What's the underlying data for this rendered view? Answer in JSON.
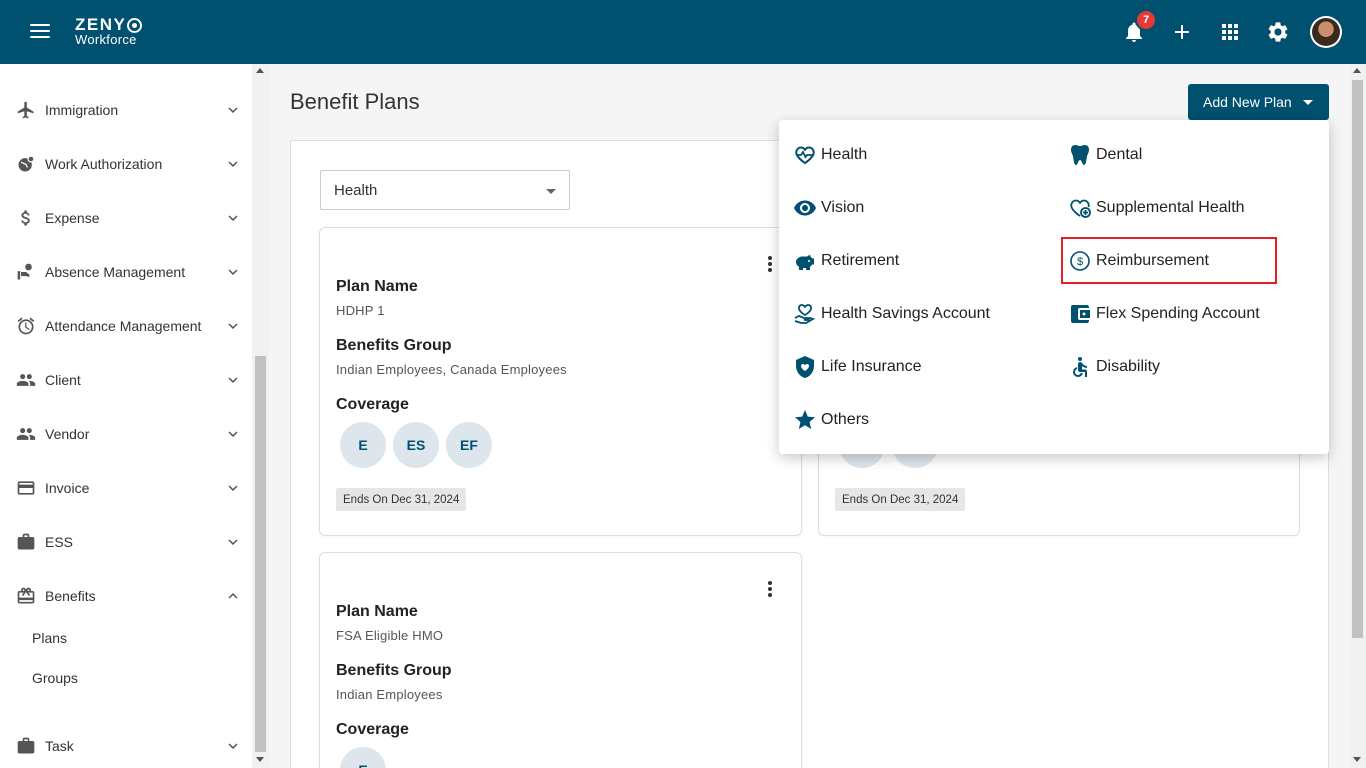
{
  "app": {
    "brand_top": "ZENY",
    "brand_bottom": "Workforce",
    "notification_count": "7"
  },
  "colors": {
    "topbar": "#00506f",
    "accent": "#00506f",
    "logo_accent": "#f39c3c",
    "badge": "#e53935",
    "highlight": "#e31e24"
  },
  "sidebar": {
    "items": [
      {
        "label": "Immigration",
        "icon": "airplane-icon"
      },
      {
        "label": "Work Authorization",
        "icon": "globe-icon"
      },
      {
        "label": "Expense",
        "icon": "dollar-icon"
      },
      {
        "label": "Absence Management",
        "icon": "absence-icon"
      },
      {
        "label": "Attendance Management",
        "icon": "alarm-clock-icon"
      },
      {
        "label": "Client",
        "icon": "people-icon"
      },
      {
        "label": "Vendor",
        "icon": "people-icon"
      },
      {
        "label": "Invoice",
        "icon": "card-icon"
      },
      {
        "label": "ESS",
        "icon": "briefcase-icon"
      },
      {
        "label": "Benefits",
        "icon": "gift-icon",
        "expanded": true
      },
      {
        "label": "Task",
        "icon": "briefcase-icon"
      }
    ],
    "benefits_sub": [
      "Plans",
      "Groups"
    ]
  },
  "main": {
    "title": "Benefit Plans",
    "add_button": "Add New Plan",
    "filter_value": "Health"
  },
  "cards": [
    {
      "plan_name_label": "Plan Name",
      "plan_name": "HDHP 1",
      "group_label": "Benefits Group",
      "group": "Indian Employees, Canada Employees",
      "coverage_label": "Coverage",
      "coverage": [
        "E",
        "ES",
        "EF"
      ],
      "ends": "Ends On Dec 31, 2024"
    },
    {
      "ends": "Ends On Dec 31, 2024"
    },
    {
      "plan_name_label": "Plan Name",
      "plan_name": "FSA Eligible HMO",
      "group_label": "Benefits Group",
      "group": "Indian Employees",
      "coverage_label": "Coverage",
      "coverage": [
        "E"
      ]
    }
  ],
  "dropdown": {
    "left": [
      {
        "label": "Health",
        "icon": "heart-pulse-icon"
      },
      {
        "label": "Vision",
        "icon": "eye-icon"
      },
      {
        "label": "Retirement",
        "icon": "piggy-bank-icon"
      },
      {
        "label": "Health Savings Account",
        "icon": "hand-heart-dollar-icon"
      },
      {
        "label": "Life Insurance",
        "icon": "shield-heart-icon"
      },
      {
        "label": "Others",
        "icon": "star-icon"
      }
    ],
    "right": [
      {
        "label": "Dental",
        "icon": "tooth-icon"
      },
      {
        "label": "Supplemental Health",
        "icon": "heart-plus-icon"
      },
      {
        "label": "Reimbursement",
        "icon": "dollar-circle-icon",
        "highlighted": true
      },
      {
        "label": "Flex Spending Account",
        "icon": "wallet-icon"
      },
      {
        "label": "Disability",
        "icon": "wheelchair-icon"
      }
    ]
  }
}
